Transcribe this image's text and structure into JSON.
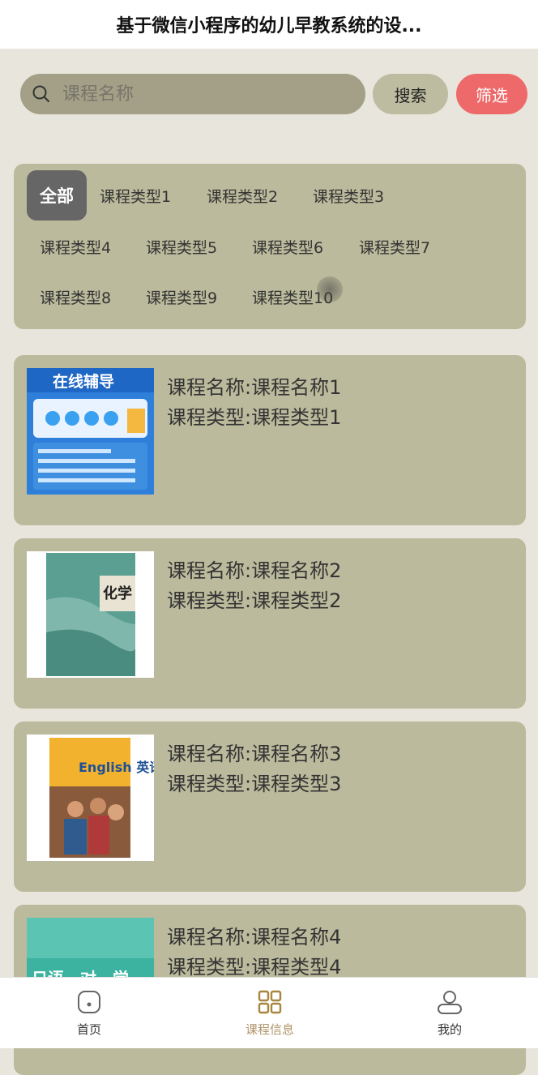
{
  "app": {
    "title": "基于微信小程序的幼儿早教系统的设..."
  },
  "search": {
    "placeholder": "课程名称",
    "value": "",
    "search_label": "搜索",
    "filter_label": "筛选"
  },
  "categories": [
    {
      "label": "全部",
      "active": true
    },
    {
      "label": "课程类型1"
    },
    {
      "label": "课程类型2"
    },
    {
      "label": "课程类型3"
    },
    {
      "label": "课程类型4"
    },
    {
      "label": "课程类型5"
    },
    {
      "label": "课程类型6"
    },
    {
      "label": "课程类型7"
    },
    {
      "label": "课程类型8"
    },
    {
      "label": "课程类型9"
    },
    {
      "label": "课程类型10"
    }
  ],
  "courses": [
    {
      "name_line": "课程名称:课程名称1",
      "type_line": "课程类型:课程类型1",
      "thumb_text": "在线辅导"
    },
    {
      "name_line": "课程名称:课程名称2",
      "type_line": "课程类型:课程类型2",
      "thumb_text": "化学"
    },
    {
      "name_line": "课程名称:课程名称3",
      "type_line": "课程类型:课程类型3",
      "thumb_text": "English 英语"
    },
    {
      "name_line": "课程名称:课程名称4",
      "type_line": "课程类型:课程类型4",
      "thumb_text": "日语一对一学"
    }
  ],
  "tabbar": {
    "items": [
      {
        "label": "首页",
        "icon": "home-icon"
      },
      {
        "label": "课程信息",
        "icon": "grid-icon",
        "active": true
      },
      {
        "label": "我的",
        "icon": "user-icon"
      }
    ]
  },
  "colors": {
    "accent_red": "#ee6a6a",
    "panel": "#bbba9c",
    "tab_active": "#b0956a"
  }
}
